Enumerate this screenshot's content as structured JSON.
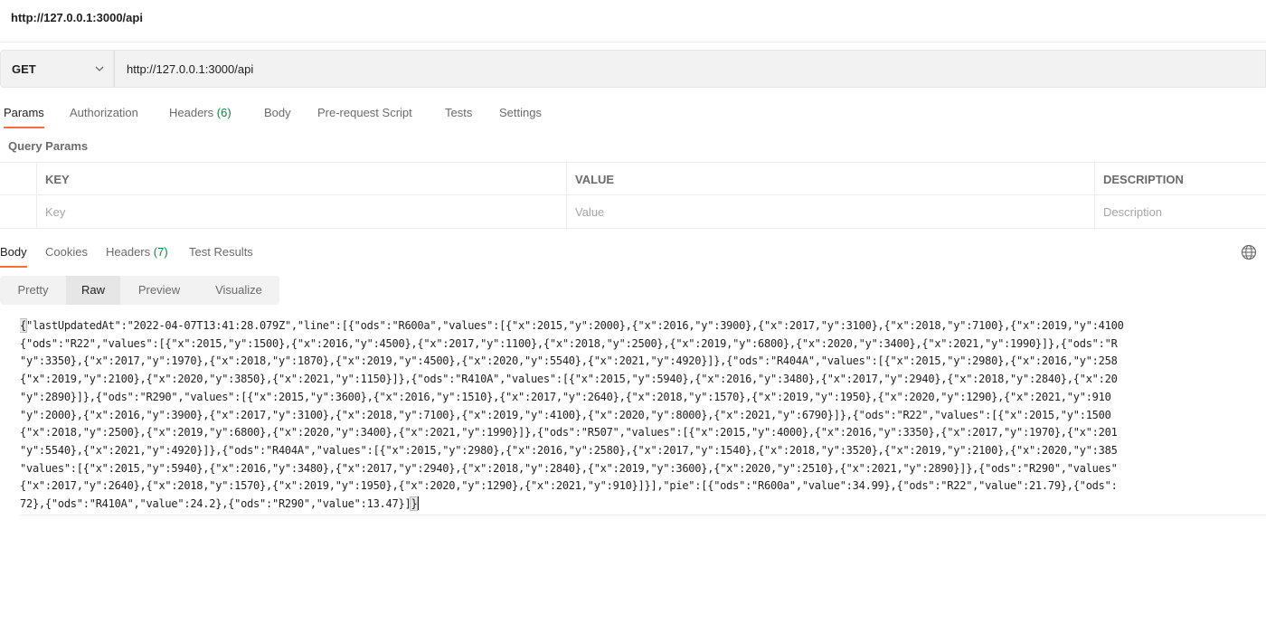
{
  "window": {
    "title": "http://127.0.0.1:3000/api"
  },
  "request": {
    "method": "GET",
    "url": "http://127.0.0.1:3000/api"
  },
  "request_tabs": {
    "params": "Params",
    "authorization": "Authorization",
    "headers_label": "Headers",
    "headers_count": "(6)",
    "body": "Body",
    "pre_request": "Pre-request Script",
    "tests": "Tests",
    "settings": "Settings"
  },
  "query_params": {
    "label": "Query Params",
    "headers": {
      "key": "KEY",
      "value": "VALUE",
      "description": "DESCRIPTION"
    },
    "placeholders": {
      "key": "Key",
      "value": "Value",
      "description": "Description"
    }
  },
  "response_tabs": {
    "body": "Body",
    "cookies": "Cookies",
    "headers_label": "Headers",
    "headers_count": "(7)",
    "test_results": "Test Results"
  },
  "view_tabs": {
    "pretty": "Pretty",
    "raw": "Raw",
    "preview": "Preview",
    "visualize": "Visualize"
  },
  "response_body": {
    "open_brace": "{",
    "close_bracket": "]",
    "close_brace": "}",
    "lines": [
      "\"lastUpdatedAt\":\"2022-04-07T13:41:28.079Z\",\"line\":[{\"ods\":\"R600a\",\"values\":[{\"x\":2015,\"y\":2000},{\"x\":2016,\"y\":3900},{\"x\":2017,\"y\":3100},{\"x\":2018,\"y\":7100},{\"x\":2019,\"y\":4100",
      "{\"ods\":\"R22\",\"values\":[{\"x\":2015,\"y\":1500},{\"x\":2016,\"y\":4500},{\"x\":2017,\"y\":1100},{\"x\":2018,\"y\":2500},{\"x\":2019,\"y\":6800},{\"x\":2020,\"y\":3400},{\"x\":2021,\"y\":1990}]},{\"ods\":\"R",
      "\"y\":3350},{\"x\":2017,\"y\":1970},{\"x\":2018,\"y\":1870},{\"x\":2019,\"y\":4500},{\"x\":2020,\"y\":5540},{\"x\":2021,\"y\":4920}]},{\"ods\":\"R404A\",\"values\":[{\"x\":2015,\"y\":2980},{\"x\":2016,\"y\":258",
      "{\"x\":2019,\"y\":2100},{\"x\":2020,\"y\":3850},{\"x\":2021,\"y\":1150}]},{\"ods\":\"R410A\",\"values\":[{\"x\":2015,\"y\":5940},{\"x\":2016,\"y\":3480},{\"x\":2017,\"y\":2940},{\"x\":2018,\"y\":2840},{\"x\":20",
      "\"y\":2890}]},{\"ods\":\"R290\",\"values\":[{\"x\":2015,\"y\":3600},{\"x\":2016,\"y\":1510},{\"x\":2017,\"y\":2640},{\"x\":2018,\"y\":1570},{\"x\":2019,\"y\":1950},{\"x\":2020,\"y\":1290},{\"x\":2021,\"y\":910",
      "\"y\":2000},{\"x\":2016,\"y\":3900},{\"x\":2017,\"y\":3100},{\"x\":2018,\"y\":7100},{\"x\":2019,\"y\":4100},{\"x\":2020,\"y\":8000},{\"x\":2021,\"y\":6790}]},{\"ods\":\"R22\",\"values\":[{\"x\":2015,\"y\":1500",
      "{\"x\":2018,\"y\":2500},{\"x\":2019,\"y\":6800},{\"x\":2020,\"y\":3400},{\"x\":2021,\"y\":1990}]},{\"ods\":\"R507\",\"values\":[{\"x\":2015,\"y\":4000},{\"x\":2016,\"y\":3350},{\"x\":2017,\"y\":1970},{\"x\":201",
      "\"y\":5540},{\"x\":2021,\"y\":4920}]},{\"ods\":\"R404A\",\"values\":[{\"x\":2015,\"y\":2980},{\"x\":2016,\"y\":2580},{\"x\":2017,\"y\":1540},{\"x\":2018,\"y\":3520},{\"x\":2019,\"y\":2100},{\"x\":2020,\"y\":385",
      "\"values\":[{\"x\":2015,\"y\":5940},{\"x\":2016,\"y\":3480},{\"x\":2017,\"y\":2940},{\"x\":2018,\"y\":2840},{\"x\":2019,\"y\":3600},{\"x\":2020,\"y\":2510},{\"x\":2021,\"y\":2890}]},{\"ods\":\"R290\",\"values\"",
      "{\"x\":2017,\"y\":2640},{\"x\":2018,\"y\":1570},{\"x\":2019,\"y\":1950},{\"x\":2020,\"y\":1290},{\"x\":2021,\"y\":910}]}],\"pie\":[{\"ods\":\"R600a\",\"value\":34.99},{\"ods\":\"R22\",\"value\":21.79},{\"ods\":",
      "72},{\"ods\":\"R410A\",\"value\":24.2},{\"ods\":\"R290\",\"value\":13.47}"
    ]
  },
  "colors": {
    "accent": "#ff6c37",
    "count_green": "#0b8a3d"
  },
  "icons": {
    "method_dropdown": "chevron-down-icon",
    "globe": "globe-icon"
  }
}
